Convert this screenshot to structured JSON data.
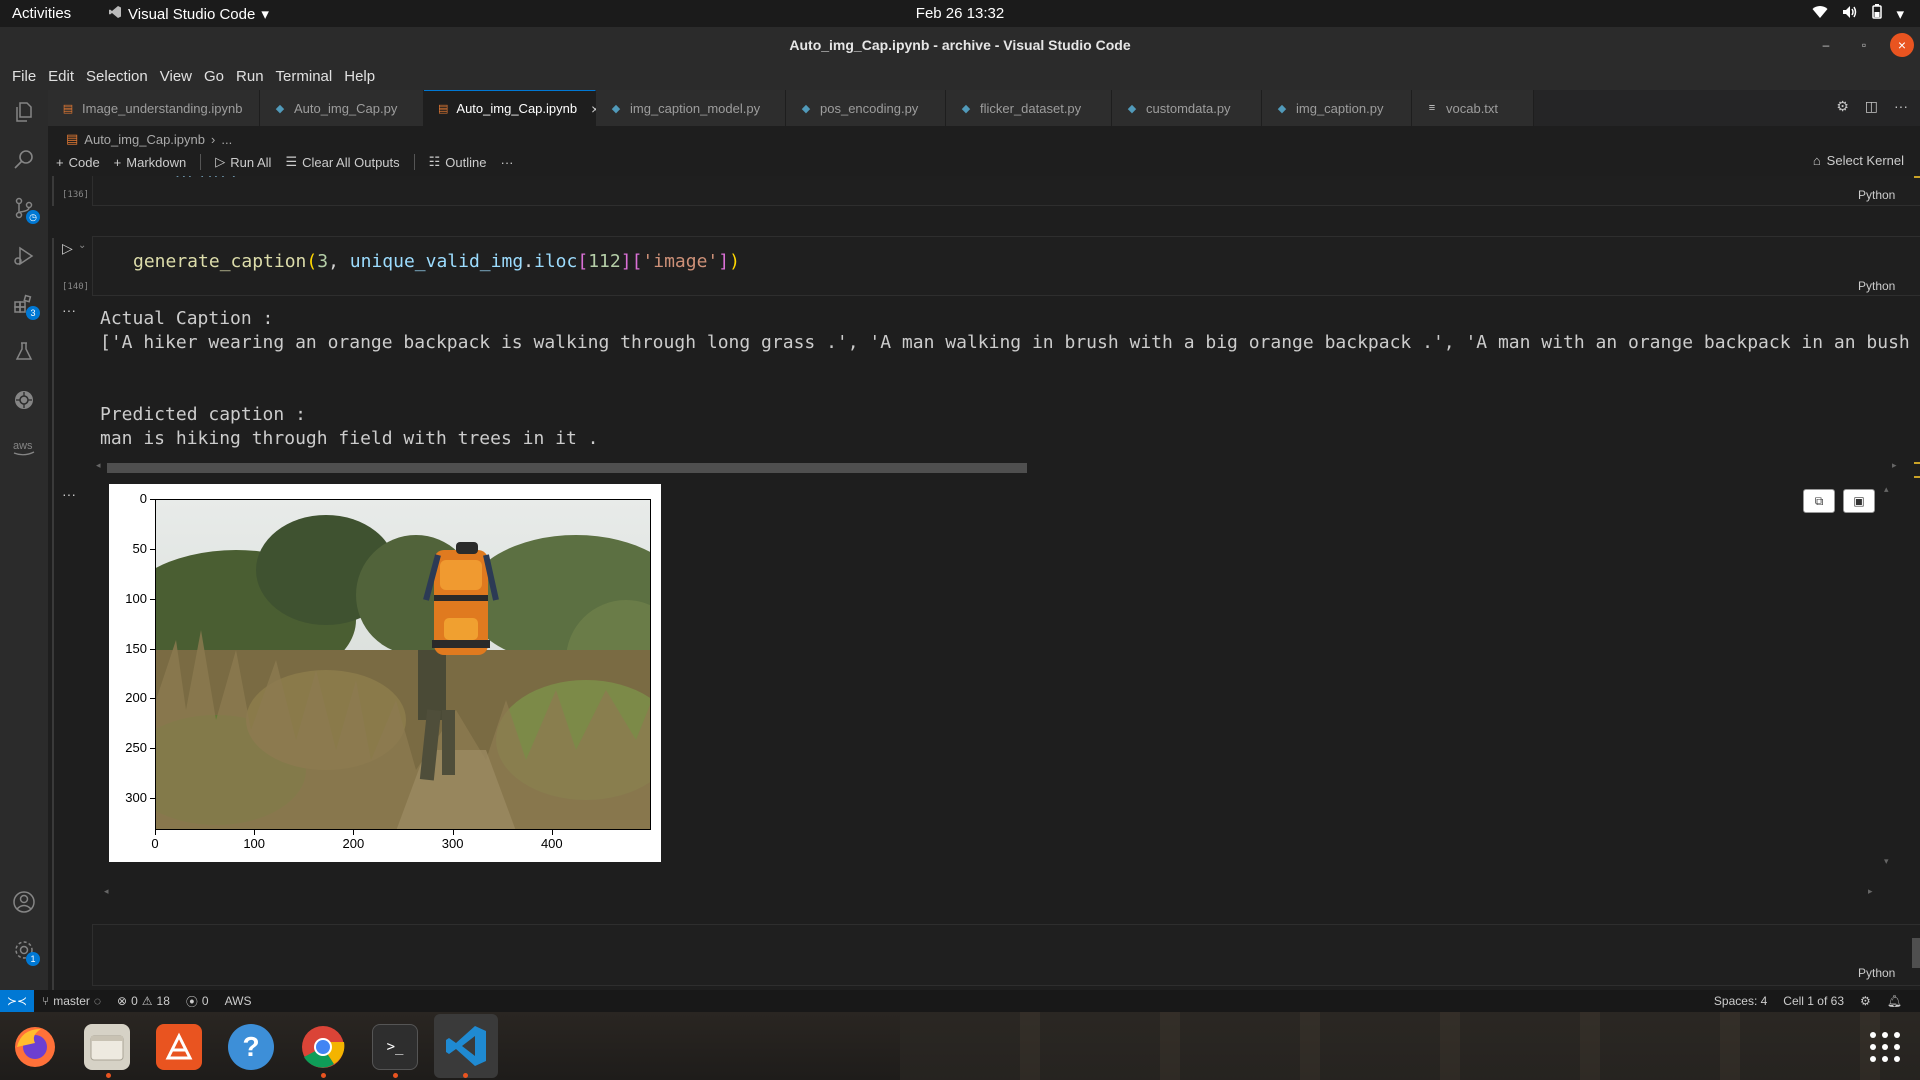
{
  "topbar": {
    "activities": "Activities",
    "app_name": "Visual Studio Code",
    "clock": "Feb 26  13:32"
  },
  "window": {
    "title": "Auto_img_Cap.ipynb - archive - Visual Studio Code"
  },
  "menu": [
    "File",
    "Edit",
    "Selection",
    "View",
    "Go",
    "Run",
    "Terminal",
    "Help"
  ],
  "activity_badges": {
    "source_control": "",
    "extensions": "3",
    "settings": "1"
  },
  "tabs": [
    {
      "label": "Image_understanding.ipynb",
      "icon": "notebook-icon",
      "active": false
    },
    {
      "label": "Auto_img_Cap.py",
      "icon": "python-file-icon",
      "active": false
    },
    {
      "label": "Auto_img_Cap.ipynb",
      "icon": "notebook-icon",
      "active": true
    },
    {
      "label": "img_caption_model.py",
      "icon": "python-file-icon",
      "active": false
    },
    {
      "label": "pos_encoding.py",
      "icon": "python-file-icon",
      "active": false
    },
    {
      "label": "flicker_dataset.py",
      "icon": "python-file-icon",
      "active": false
    },
    {
      "label": "customdata.py",
      "icon": "python-file-icon",
      "active": false
    },
    {
      "label": "img_caption.py",
      "icon": "python-file-icon",
      "active": false
    },
    {
      "label": "vocab.txt",
      "icon": "text-file-icon",
      "active": false
    }
  ],
  "breadcrumb": {
    "file": "Auto_img_Cap.ipynb",
    "more": "..."
  },
  "nb_toolbar": {
    "code": "Code",
    "markdown": "Markdown",
    "run_all": "Run All",
    "clear_outputs": "Clear All Outputs",
    "outline": "Outline",
    "more": "···",
    "kernel": "Select Kernel"
  },
  "cells": {
    "prev_exec_count": "[136]",
    "prev_lang": "Python",
    "exec_count": "[140]",
    "lang": "Python",
    "code_parts": {
      "fn": "generate_caption",
      "open": "(",
      "num": "3",
      "comma": ", ",
      "var": "unique_valid_img",
      "dot": ".",
      "attr": "iloc",
      "idx_open": "[",
      "idx": "112",
      "idx_close": "]",
      "key_open": "[",
      "key": "'image'",
      "key_close": "]",
      "close": ")"
    },
    "output_text": {
      "actual_label": "Actual Caption :",
      "actual_value": "['A hiker wearing an orange backpack is walking through long grass .', 'A man walking in brush with a big orange backpack .', 'A man with an orange backpack in an bush",
      "predicted_label": "Predicted caption :",
      "predicted_value": "man is hiking through field with trees in it ."
    },
    "last_lang": "Python"
  },
  "plot": {
    "y_ticks": [
      "0",
      "50",
      "100",
      "150",
      "200",
      "250",
      "300"
    ],
    "x_ticks": [
      "0",
      "100",
      "200",
      "300",
      "400"
    ]
  },
  "statusbar": {
    "branch": "master",
    "errors": "0",
    "warnings": "18",
    "ports": "0",
    "aws": "AWS",
    "spaces": "Spaces: 4",
    "cell": "Cell 1 of 63"
  },
  "colors": {
    "accent": "#0078d4",
    "ubuntu_orange": "#e95420"
  }
}
